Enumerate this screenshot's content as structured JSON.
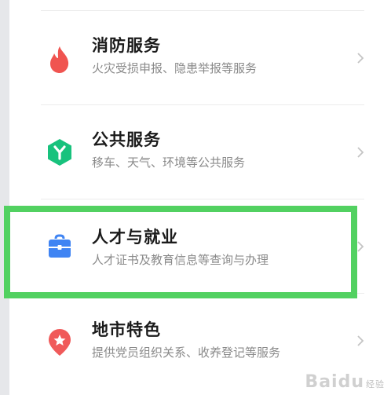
{
  "services": [
    {
      "title": "消防服务",
      "subtitle": "火灾受损申报、隐患举报等服务",
      "icon": "fire-icon",
      "color": "#f05450"
    },
    {
      "title": "公共服务",
      "subtitle": "移车、天气、环境等公共服务",
      "icon": "hexagon-y-icon",
      "color": "#18c27d"
    },
    {
      "title": "人才与就业",
      "subtitle": "人才证书及教育信息等查询与办理",
      "icon": "briefcase-icon",
      "color": "#3f84f3"
    },
    {
      "title": "地市特色",
      "subtitle": "提供党员组织关系、收养登记等服务",
      "icon": "location-pin-star-icon",
      "color": "#f05a5a"
    }
  ],
  "highlight_color": "#52d161",
  "watermark": {
    "main": "Baidu",
    "sub": "经验"
  }
}
